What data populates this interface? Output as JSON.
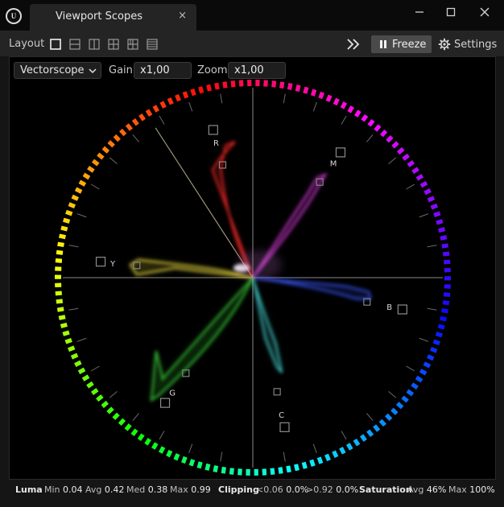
{
  "window": {
    "tab_title": "Viewport Scopes",
    "close_glyph": "×",
    "minimize_glyph": "—",
    "maximize_glyph": "☐",
    "window_close_glyph": "✕"
  },
  "toolbar": {
    "layout_label": "Layout",
    "layout_options": [
      "single",
      "split-horizontal",
      "split-vertical",
      "quad",
      "grid",
      "list"
    ],
    "freeze_label": "Freeze",
    "settings_label": "Settings"
  },
  "controls": {
    "mode": "Vectorscope",
    "gain_label": "Gain",
    "gain_value": "x1,00",
    "zoom_label": "Zoom",
    "zoom_value": "x1,00"
  },
  "vectorscope": {
    "targets": [
      {
        "label": "R",
        "hue": 0
      },
      {
        "label": "M",
        "hue": 300
      },
      {
        "label": "B",
        "hue": 240
      },
      {
        "label": "C",
        "hue": 180
      },
      {
        "label": "G",
        "hue": 120
      },
      {
        "label": "Y",
        "hue": 60
      }
    ],
    "skin_tone_line": true
  },
  "status": {
    "luma_label": "Luma",
    "min_label": "Min",
    "min_value": "0.04",
    "avg_label": "Avg",
    "avg_value": "0.42",
    "med_label": "Med",
    "med_value": "0.38",
    "max_label": "Max",
    "max_value": "0.99",
    "clipping_label": "Clipping",
    "clip_low_label": "<0.06",
    "clip_low_value": "0.0%",
    "clip_high_label": ">0.92",
    "clip_high_value": "0.0%",
    "saturation_label": "Saturation",
    "sat_avg_label": "Avg",
    "sat_avg_value": "46%",
    "sat_max_label": "Max",
    "sat_max_value": "100%"
  }
}
